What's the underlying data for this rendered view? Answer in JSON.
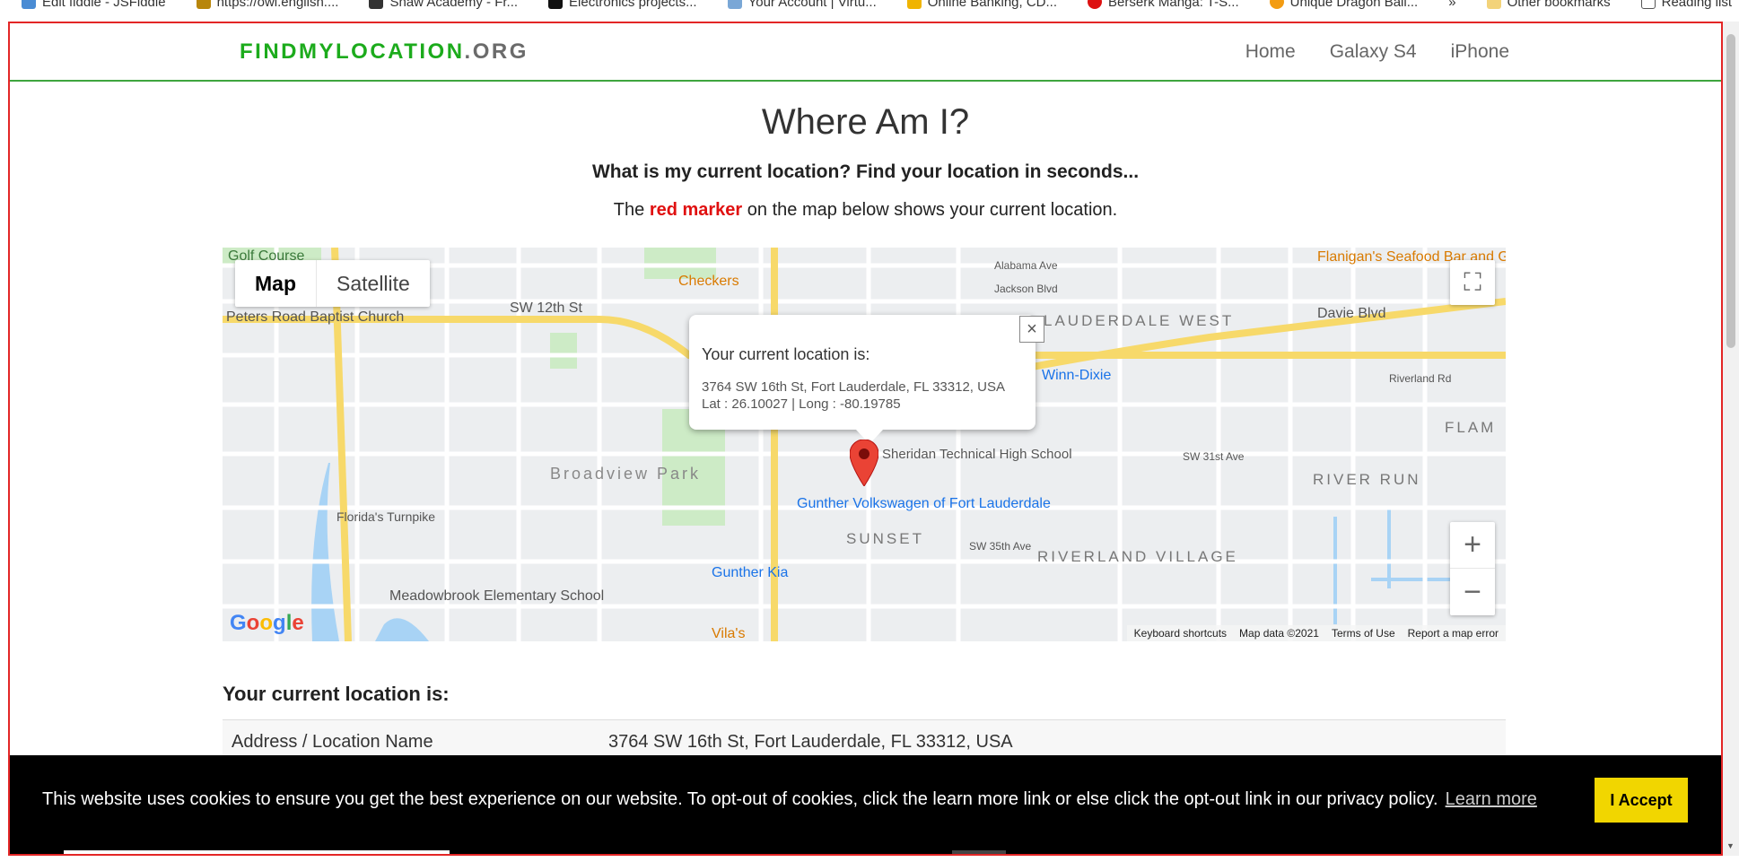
{
  "bookmarks": {
    "items": [
      "Edit fiddle - JSFiddle",
      "https://owl.english....",
      "Shaw Academy - Fr...",
      "Electronics projects...",
      "Your Account | Virtu...",
      "Online Banking, CD...",
      "Berserk Manga: T-S...",
      "Unique Dragon Ball..."
    ],
    "more": "»",
    "other": "Other bookmarks",
    "reading": "Reading list"
  },
  "header": {
    "logo_main": "FINDMYLOCATION",
    "logo_tld": ".ORG",
    "nav": [
      "Home",
      "Galaxy S4",
      "iPhone"
    ]
  },
  "page": {
    "title": "Where Am I?",
    "subtitle": "What is my current location? Find your location in seconds...",
    "desc_pre": "The ",
    "desc_red": "red marker",
    "desc_post": " on the map below shows your current location."
  },
  "map": {
    "type_map": "Map",
    "type_satellite": "Satellite",
    "zoom_in": "+",
    "zoom_out": "−",
    "google": "Google",
    "labels": [
      "Golf Course",
      "Peters Road Baptist Church",
      "SW 12th St",
      "Checkers",
      "Alabama Ave",
      "Jackson Blvd",
      "LAUDERDALE WEST",
      "Davie Blvd",
      "Flanigan's Seafood Bar and Grill",
      "Broadview Park",
      "Gunther Volkswagen of Fort Lauderdale",
      "SUNSET",
      "Gunther Kia",
      "Meadowbrook Elementary School",
      "RIVERLAND VILLAGE",
      "RIVER RUN",
      "Florida's Turnpike",
      "Sheridan Technical High School",
      "Winn-Dixie",
      "Vila's",
      "FLAM",
      "SW 31st Ave",
      "SW 35th Ave",
      "Riverland Rd"
    ],
    "attribution": [
      "Keyboard shortcuts",
      "Map data ©2021",
      "Terms of Use",
      "Report a map error"
    ],
    "info_heading": "Your current location is:",
    "info_address": "3764 SW 16th St, Fort Lauderdale, FL 33312, USA",
    "info_latlong": "Lat : 26.10027 | Long : -80.19785",
    "close": "×"
  },
  "location": {
    "heading": "Your current location is:",
    "row_key": "Address / Location Name",
    "row_value": "3764 SW 16th St, Fort Lauderdale, FL 33312, USA"
  },
  "cookie": {
    "message": "This website uses cookies to ensure you get the best experience on our website. To opt-out of cookies, click the learn more link or else click the opt-out link in our privacy policy.",
    "learn_more": "Learn more",
    "accept": "I Accept"
  },
  "colors": {
    "brand_green": "#1cab1c",
    "frame_red": "#e32626",
    "marker_red": "#e01010",
    "accept_yellow": "#f1d600"
  }
}
